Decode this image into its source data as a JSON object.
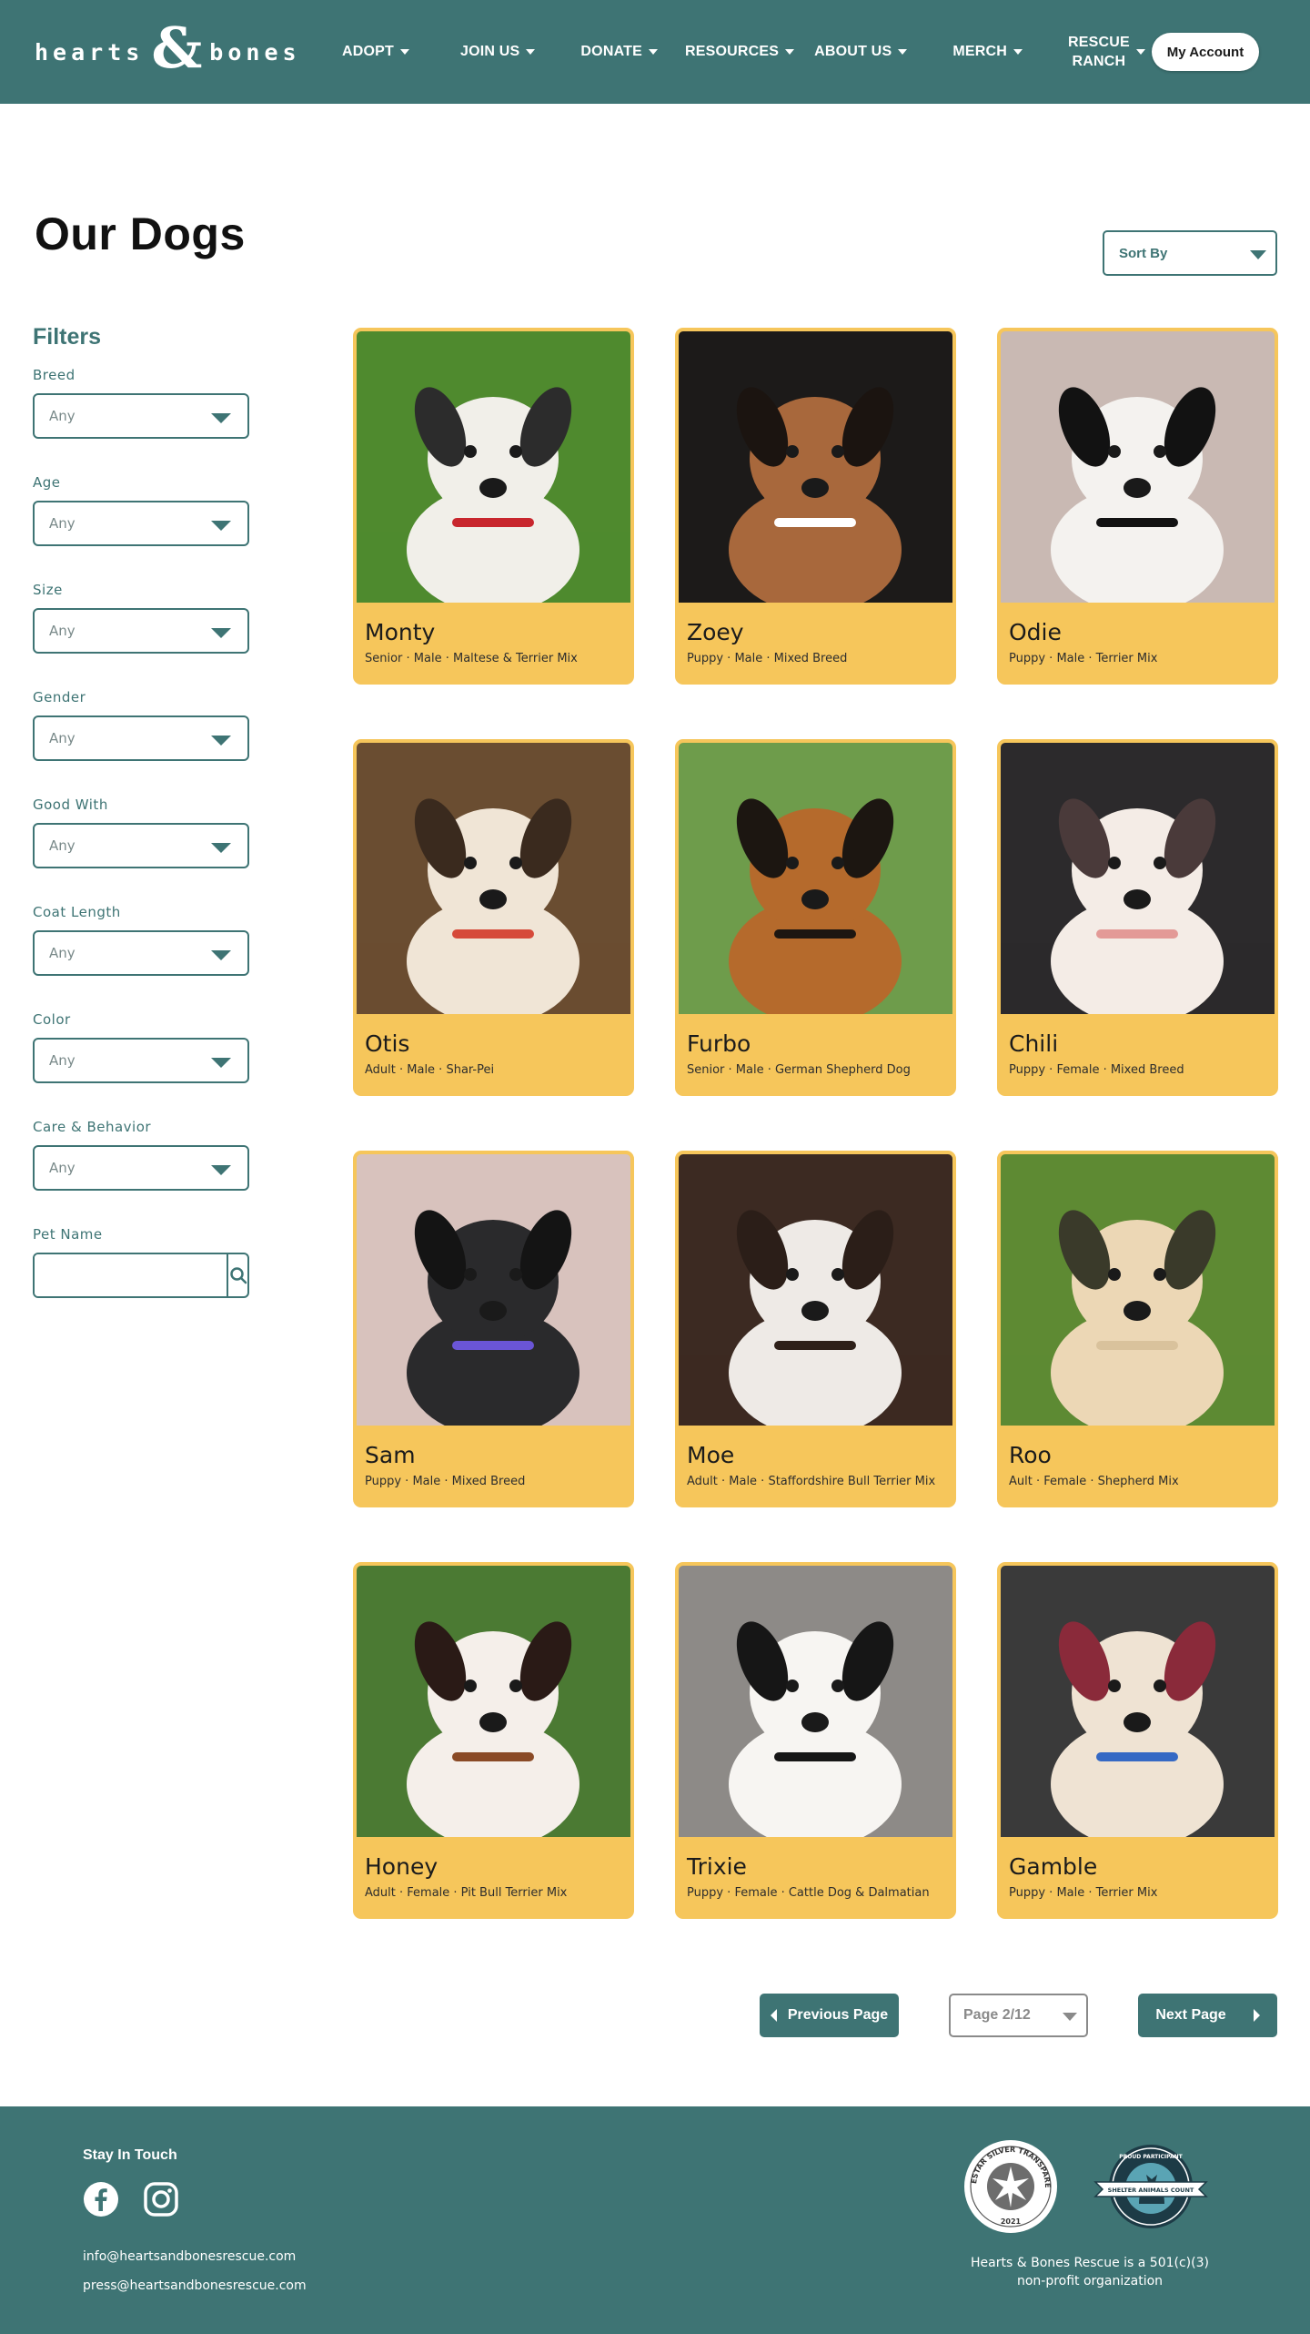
{
  "header": {
    "logo_left": "hearts",
    "logo_amp": "&",
    "logo_right": "bones",
    "nav": [
      {
        "label": "ADOPT"
      },
      {
        "label": "JOIN US"
      },
      {
        "label": "DONATE"
      },
      {
        "label": "RESOURCES"
      },
      {
        "label": "ABOUT US"
      },
      {
        "label": "MERCH"
      },
      {
        "label": "RESCUE\nRANCH"
      }
    ],
    "account_label": "My Account"
  },
  "page": {
    "title": "Our Dogs",
    "sort_label": "Sort By"
  },
  "filters": {
    "heading": "Filters",
    "groups": [
      {
        "label": "Breed",
        "value": "Any"
      },
      {
        "label": "Age",
        "value": "Any"
      },
      {
        "label": "Size",
        "value": "Any"
      },
      {
        "label": "Gender",
        "value": "Any"
      },
      {
        "label": "Good With",
        "value": "Any"
      },
      {
        "label": "Coat Length",
        "value": "Any"
      },
      {
        "label": "Color",
        "value": "Any"
      },
      {
        "label": "Care & Behavior",
        "value": "Any"
      }
    ],
    "pet_name_label": "Pet Name",
    "pet_name_value": ""
  },
  "dogs": [
    {
      "name": "Monty",
      "meta": "Senior · Male · Maltese & Terrier Mix",
      "bg": "#4f8a2e",
      "fur": "#f1efe9",
      "accent": "#c8262d",
      "dark": "#2c2c2c"
    },
    {
      "name": "Zoey",
      "meta": "Puppy · Male · Mixed Breed",
      "bg": "#1c1a19",
      "fur": "#a8683c",
      "accent": "#ffffff",
      "dark": "#1b1410"
    },
    {
      "name": "Odie",
      "meta": "Puppy · Male · Terrier Mix",
      "bg": "#c9b9b3",
      "fur": "#f4f2ef",
      "accent": "#121212",
      "dark": "#121212"
    },
    {
      "name": "Otis",
      "meta": "Adult · Male ·  Shar-Pei",
      "bg": "#6a4d31",
      "fur": "#f0e5d6",
      "accent": "#d64a3a",
      "dark": "#3a2a1e"
    },
    {
      "name": "Furbo",
      "meta": "Senior · Male · German Shepherd Dog",
      "bg": "#6e9c4b",
      "fur": "#b56a2c",
      "accent": "#1c1611",
      "dark": "#1c1611"
    },
    {
      "name": "Chili",
      "meta": "Puppy · Female · Mixed Breed",
      "bg": "#2c2a2c",
      "fur": "#f4ece6",
      "accent": "#e39a97",
      "dark": "#4a3a3a"
    },
    {
      "name": "Sam",
      "meta": "Puppy · Male · Mixed Breed",
      "bg": "#d8c2bd",
      "fur": "#2a2a2c",
      "accent": "#6a55d6",
      "dark": "#141414"
    },
    {
      "name": "Moe",
      "meta": "Adult · Male · Staffordshire Bull Terrier Mix",
      "bg": "#3c2a22",
      "fur": "#eeeae6",
      "accent": "#2e2019",
      "dark": "#2b1e18"
    },
    {
      "name": "Roo",
      "meta": "Ault · Female · Shepherd Mix",
      "bg": "#5e8a33",
      "fur": "#ecd7b5",
      "accent": "#d9c29c",
      "dark": "#3a3a2a"
    },
    {
      "name": "Honey",
      "meta": "Adult · Female · Pit Bull Terrier Mix",
      "bg": "#4b7a33",
      "fur": "#f5efea",
      "accent": "#8a4a26",
      "dark": "#2a1a16"
    },
    {
      "name": "Trixie",
      "meta": "Puppy · Female ·  Cattle Dog & Dalmatian",
      "bg": "#8d8a87",
      "fur": "#f7f5f2",
      "accent": "#161616",
      "dark": "#161616"
    },
    {
      "name": "Gamble",
      "meta": "Puppy · Male · Terrier Mix",
      "bg": "#3a3a3a",
      "fur": "#efe3d3",
      "accent": "#3569c4",
      "dark": "#8a2a3a"
    }
  ],
  "pagination": {
    "prev_label": "Previous Page",
    "page_value": "Page 2/12",
    "next_label": "Next Page"
  },
  "footer": {
    "stay_label": "Stay In Touch",
    "social_icons": [
      "facebook-icon",
      "instagram-icon"
    ],
    "email_info": "info@heartsandbonesrescue.com",
    "email_press": "press@heartsandbonesrescue.com",
    "badge_guidestar_text": "GUIDESTAR SILVER TRANSPARENCY",
    "badge_guidestar_year": "2021",
    "badge_partner_text": "PROUD PARTICIPANT",
    "badge_partner_sub": "SHELTER ANIMALS COUNT",
    "nonprofit": "Hearts & Bones Rescue is a 501(c)(3)\nnon-profit organization"
  },
  "colors": {
    "teal": "#3e7474",
    "card_yellow": "#f6c65b"
  }
}
